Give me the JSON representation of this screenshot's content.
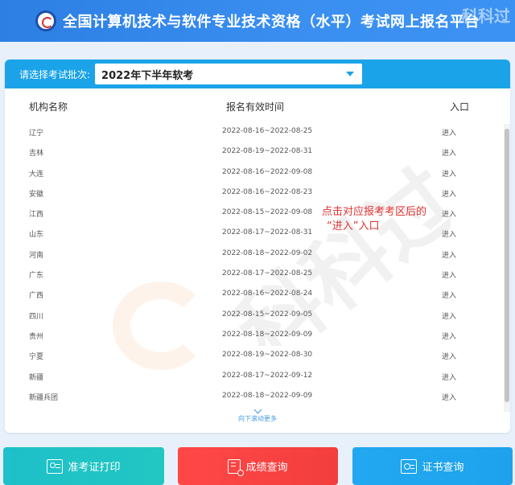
{
  "header": {
    "title": "全国计算机技术与软件专业技术资格（水平）考试网上报名平台",
    "watermark": "科科过",
    "accent": "#2d7fe3"
  },
  "selector": {
    "label": "请选择考试批次:",
    "value": "2022年下半年软考",
    "icon": "caret-down-icon"
  },
  "table": {
    "columns": [
      "机构名称",
      "报名有效时间",
      "入口"
    ],
    "rows": [
      {
        "name": "辽宁",
        "time": "2022-08-16~2022-08-25",
        "entry": "进入"
      },
      {
        "name": "吉林",
        "time": "2022-08-19~2022-08-31",
        "entry": "进入"
      },
      {
        "name": "大连",
        "time": "2022-08-16~2022-09-08",
        "entry": "进入"
      },
      {
        "name": "安徽",
        "time": "2022-08-16~2022-08-23",
        "entry": "进入"
      },
      {
        "name": "江西",
        "time": "2022-08-15~2022-09-08",
        "entry": "进入"
      },
      {
        "name": "山东",
        "time": "2022-08-17~2022-08-31",
        "entry": "进入"
      },
      {
        "name": "河南",
        "time": "2022-08-18~2022-09-02",
        "entry": "进入"
      },
      {
        "name": "广东",
        "time": "2022-08-17~2022-08-25",
        "entry": "进入"
      },
      {
        "name": "广西",
        "time": "2022-08-16~2022-08-24",
        "entry": "进入"
      },
      {
        "name": "四川",
        "time": "2022-08-15~2022-09-05",
        "entry": "进入"
      },
      {
        "name": "贵州",
        "time": "2022-08-18~2022-09-09",
        "entry": "进入"
      },
      {
        "name": "宁夏",
        "time": "2022-08-19~2022-08-30",
        "entry": "进入"
      },
      {
        "name": "新疆",
        "time": "2022-08-17~2022-09-12",
        "entry": "进入"
      },
      {
        "name": "新疆兵团",
        "time": "2022-08-18~2022-09-09",
        "entry": "进入"
      }
    ],
    "scroll_hint": "向下滚动更多"
  },
  "annotation": {
    "line1": "点击对应报考考区后的",
    "line2": "“进入”入口",
    "color": "#e03232"
  },
  "watermark_center": "科科过",
  "buttons": [
    {
      "label": "准考证打印",
      "icon": "id-card-icon",
      "color": "#1ec0c9"
    },
    {
      "label": "成绩查询",
      "icon": "score-search-icon",
      "color": "#ff4747"
    },
    {
      "label": "证书查询",
      "icon": "certificate-icon",
      "color": "#21a8f0"
    }
  ]
}
